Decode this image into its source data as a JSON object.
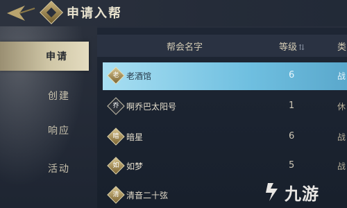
{
  "header": {
    "title": "申请入帮",
    "back_icon": "back-arrow-icon"
  },
  "sidebar": {
    "items": [
      {
        "label": "申请",
        "active": true
      },
      {
        "label": "创建",
        "active": false
      },
      {
        "label": "响应",
        "active": false
      },
      {
        "label": "活动",
        "active": false
      }
    ]
  },
  "table": {
    "columns": {
      "name": "帮会名字",
      "level": "等级",
      "type": "类"
    },
    "rows": [
      {
        "glyph": "老",
        "name": "老酒馆",
        "level": "6",
        "type": "战",
        "selected": true
      },
      {
        "glyph": "乔",
        "name": "啊乔巴太阳号",
        "level": "1",
        "type": "休",
        "selected": false
      },
      {
        "glyph": "暗",
        "name": "暗星",
        "level": "6",
        "type": "战",
        "selected": false
      },
      {
        "glyph": "如",
        "name": "如梦",
        "level": "5",
        "type": "战",
        "selected": false
      },
      {
        "glyph": "清",
        "name": "清音二十弦",
        "level": "",
        "type": "",
        "selected": false
      }
    ]
  },
  "watermark": {
    "text": "九游"
  },
  "colors": {
    "accent_gold": "#c9b27a",
    "selected_row": "#7cc9e8",
    "menu_active": "#d6cdb0"
  }
}
